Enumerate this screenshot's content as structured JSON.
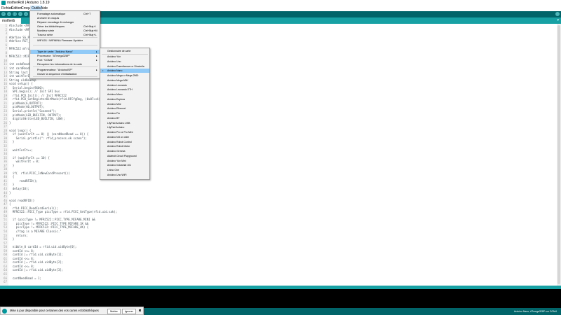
{
  "window": {
    "title": "motherRoll | Arduino 1.8.19"
  },
  "menu": [
    {
      "label": "Fichier",
      "active": false
    },
    {
      "label": "Édition",
      "active": false
    },
    {
      "label": "Croquis",
      "active": false
    },
    {
      "label": "Outils",
      "active": true
    },
    {
      "label": "Aide",
      "active": false
    }
  ],
  "toolbar": {
    "buttons": [
      "✓",
      "→",
      "▢",
      "↑",
      "↓"
    ]
  },
  "tabs": [
    {
      "label": "motherb"
    }
  ],
  "tab_menu_glyph": "▾",
  "tools_menu": [
    {
      "label": "Formatage automatique",
      "shortcut": "Ctrl+T"
    },
    {
      "label": "Archiver le croquis",
      "shortcut": ""
    },
    {
      "label": "Réparer encodage & recharger",
      "shortcut": ""
    },
    {
      "label": "Gérer les bibliothèques",
      "shortcut": "Ctrl+Maj+I"
    },
    {
      "label": "Moniteur série",
      "shortcut": "Ctrl+Maj+M"
    },
    {
      "label": "Traceur série",
      "shortcut": "Ctrl+Maj+L"
    },
    {
      "label": "WiFi101 / WiFiNINA Firmware Updater",
      "shortcut": ""
    },
    {
      "label": "Type de carte: \"Arduino Nano\"",
      "shortcut": "",
      "submenu": true
    },
    {
      "label": "Processeur: \"ATmega328P\"",
      "shortcut": "",
      "submenu": true
    },
    {
      "label": "Port: \"COM4\"",
      "shortcut": "",
      "submenu": true
    },
    {
      "label": "Récupérer les informations de la carte",
      "shortcut": ""
    },
    {
      "label": "Programmateur: \"ArduinoISP\"",
      "shortcut": "",
      "submenu": true
    },
    {
      "label": "Graver la séquence d'initialisation",
      "shortcut": ""
    }
  ],
  "board_submenu": [
    {
      "label": "Gestionnaire de carte",
      "checked": false
    },
    {
      "label": "Arduino Yún",
      "checked": false
    },
    {
      "label": "Arduino Uno",
      "checked": false
    },
    {
      "label": "Arduino Duemilanove or Diecimila",
      "checked": false
    },
    {
      "label": "Arduino Nano",
      "checked": true
    },
    {
      "label": "Arduino Mega or Mega 2560",
      "checked": false
    },
    {
      "label": "Arduino Mega ADK",
      "checked": false
    },
    {
      "label": "Arduino Leonardo",
      "checked": false
    },
    {
      "label": "Arduino Leonardo ETH",
      "checked": false
    },
    {
      "label": "Arduino Micro",
      "checked": false
    },
    {
      "label": "Arduino Esplora",
      "checked": false
    },
    {
      "label": "Arduino Mini",
      "checked": false
    },
    {
      "label": "Arduino Ethernet",
      "checked": false
    },
    {
      "label": "Arduino Fio",
      "checked": false
    },
    {
      "label": "Arduino BT",
      "checked": false
    },
    {
      "label": "LilyPad Arduino USB",
      "checked": false
    },
    {
      "label": "LilyPad Arduino",
      "checked": false
    },
    {
      "label": "Arduino Pro or Pro Mini",
      "checked": false
    },
    {
      "label": "Arduino NG or older",
      "checked": false
    },
    {
      "label": "Arduino Robot Control",
      "checked": false
    },
    {
      "label": "Arduino Robot Motor",
      "checked": false
    },
    {
      "label": "Arduino Gemma",
      "checked": false
    },
    {
      "label": "Adafruit Circuit Playground",
      "checked": false
    },
    {
      "label": "Arduino Yún Mini",
      "checked": false
    },
    {
      "label": "Arduino Industrial 101",
      "checked": false
    },
    {
      "label": "Linino One",
      "checked": false
    },
    {
      "label": "Arduino Uno WiFi",
      "checked": false
    }
  ],
  "code": [
    {
      "n": "1",
      "t": "#include <MF"
    },
    {
      "n": "2",
      "t": "#include <MF"
    },
    {
      "n": "3",
      "t": ""
    },
    {
      "n": "4",
      "t": "#define SS_P"
    },
    {
      "n": "5",
      "t": "#define RST_"
    },
    {
      "n": "6",
      "t": ""
    },
    {
      "n": "7",
      "t": "MFRC522 mfrc"
    },
    {
      "n": "8",
      "t": ""
    },
    {
      "n": "9",
      "t": "MFRC522::MIF"
    },
    {
      "n": "10",
      "t": ""
    },
    {
      "n": "11",
      "t": "int codeRead"
    },
    {
      "n": "12",
      "t": "int cardRead"
    },
    {
      "n": "13",
      "t": "String last"
    },
    {
      "n": "14",
      "t": "int waitForI"
    },
    {
      "n": "15",
      "t": "String oldReadxp"
    },
    {
      "n": "16",
      "t": "void setup() {"
    },
    {
      "n": "17",
      "t": "  Serial.begin(9600);"
    },
    {
      "n": "18",
      "t": "  SPI.begin(); // Init SPI bus"
    },
    {
      "n": "19",
      "t": "  rfid.PCD_Init(); // Init MFRC522"
    },
    {
      "n": "20",
      "t": "  rfid.PCD_SetRegisterBitMask(rfid.RFCfgReg, (0x07<<4));"
    },
    {
      "n": "21",
      "t": "  pinMode(6,OUTPUT);"
    },
    {
      "n": "22",
      "t": "  pinMode(A0,OUTPUT);"
    },
    {
      "n": "23",
      "t": "  Serial.println(\"Scanned\");"
    },
    {
      "n": "24",
      "t": "  pinMode(LED_BUILTIN, OUTPUT);"
    },
    {
      "n": "25",
      "t": "  digitalWrite(LED_BUILTIN, LOW);"
    },
    {
      "n": "26",
      "t": "}"
    },
    {
      "n": "27",
      "t": ""
    },
    {
      "n": "28",
      "t": "void loop() {"
    },
    {
      "n": "29",
      "t": "  if (waitForIt == 0) || (cardNeedRead == 0)) {"
    },
    {
      "n": "30",
      "t": "    Serial.println(\": rfid_process.ok scann\");"
    },
    {
      "n": "31",
      "t": "  }"
    },
    {
      "n": "32",
      "t": ""
    },
    {
      "n": "33",
      "t": "  waitForIt++;"
    },
    {
      "n": "34",
      "t": ""
    },
    {
      "n": "35",
      "t": "  if (waitForIt == 10) {"
    },
    {
      "n": "36",
      "t": "    waitForIt = 0;"
    },
    {
      "n": "37",
      "t": "  }"
    },
    {
      "n": "38",
      "t": ""
    },
    {
      "n": "39",
      "t": "  if(  rfid.PICC_IsNewCardPresent())"
    },
    {
      "n": "40",
      "t": "  {"
    },
    {
      "n": "41",
      "t": "      readRFID();"
    },
    {
      "n": "42",
      "t": "  }"
    },
    {
      "n": "43",
      "t": "  delay(10);"
    },
    {
      "n": "44",
      "t": "}"
    },
    {
      "n": "45",
      "t": ""
    },
    {
      "n": "46",
      "t": "void readRFID()"
    },
    {
      "n": "47",
      "t": "{"
    },
    {
      "n": "48",
      "t": "  rfid.PICC_ReadCardSerial();"
    },
    {
      "n": "49",
      "t": "  MFRC522::PICC_Type piccType = rfid.PICC_GetType(rfid.uid.sak);"
    },
    {
      "n": "50",
      "t": ""
    },
    {
      "n": "51",
      "t": "  if (piccType != MFRC522::PICC_TYPE_MIFARE_MINI &&"
    },
    {
      "n": "52",
      "t": "    piccType != MFRC522::PICC_TYPE_MIFARE_1K &&"
    },
    {
      "n": "53",
      "t": "    piccType != MFRC522::PICC_TYPE_MIFARE_4K) {"
    },
    {
      "n": "54",
      "t": "    //tag is a MIFARE Classic.\""
    },
    {
      "n": "55",
      "t": "    return;"
    },
    {
      "n": "56",
      "t": "  }"
    },
    {
      "n": "57",
      "t": ""
    },
    {
      "n": "58",
      "t": "  nibble_0 cardId = rfid.uid.uidByte[0];"
    },
    {
      "n": "59",
      "t": "  cardId <<= 8;"
    },
    {
      "n": "60",
      "t": "  cardId |= rfid.uid.uidByte[1];"
    },
    {
      "n": "61",
      "t": "  cardId <<= 8;"
    },
    {
      "n": "62",
      "t": "  cardId |= rfid.uid.uidByte[2];"
    },
    {
      "n": "63",
      "t": "  cardId <<= 8;"
    },
    {
      "n": "64",
      "t": "  cardId |= rfid.uid.uidByte[3];"
    },
    {
      "n": "65",
      "t": ""
    },
    {
      "n": "66",
      "t": "  cardNeedRead = 1;"
    },
    {
      "n": "67",
      "t": ""
    }
  ],
  "status": {
    "board_info": "Arduino Nano, ATmega328P sur COM4"
  },
  "notification": {
    "text": "Mise à jour disponible pour certaines des vos cartes et bibliothèques",
    "update_label": "Mettre",
    "ignore_label": "Ignorer",
    "close_label": "✖"
  },
  "colors": {
    "teal_dark": "#006468",
    "teal": "#17a1a5",
    "menu_highlight": "#91c9f7",
    "console": "#000000"
  }
}
